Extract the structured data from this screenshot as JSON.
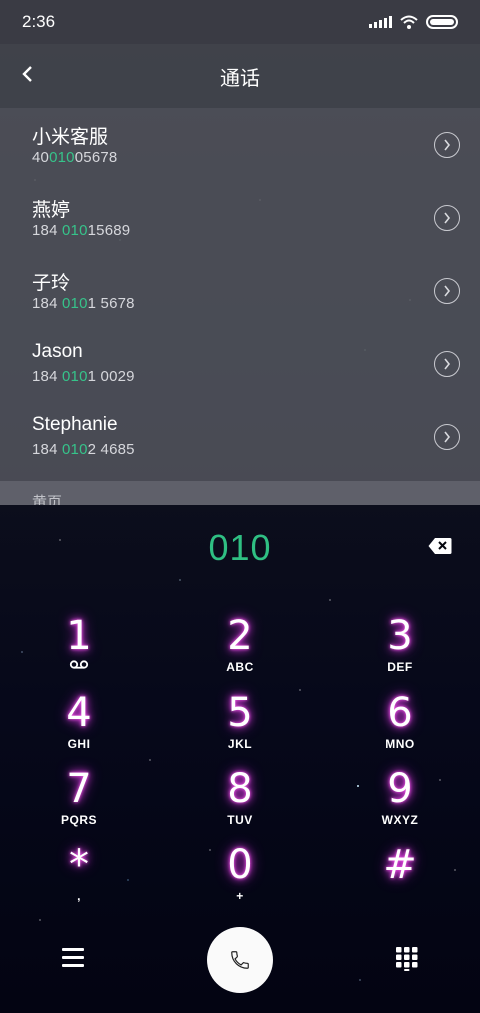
{
  "status_bar": {
    "time": "2:36"
  },
  "header": {
    "title": "通话"
  },
  "contacts": [
    {
      "name": "小米客服",
      "number_pre": "40",
      "number_match": "010",
      "number_post": "05678"
    },
    {
      "name": "燕婷",
      "number_pre": "184 ",
      "number_match": "010",
      "number_post": "15689"
    },
    {
      "name": "子玲",
      "number_pre": "184 ",
      "number_match": "010",
      "number_post": "1 5678"
    },
    {
      "name": "Jason",
      "number_pre": "184 ",
      "number_match": "010",
      "number_post": "1 0029"
    },
    {
      "name": "Stephanie",
      "number_pre": "184 ",
      "number_match": "010",
      "number_post": "2 4685"
    }
  ],
  "section_header": "黄页",
  "dialer": {
    "input": "010"
  },
  "keypad": [
    {
      "digit": "1",
      "letters": ""
    },
    {
      "digit": "2",
      "letters": "ABC"
    },
    {
      "digit": "3",
      "letters": "DEF"
    },
    {
      "digit": "4",
      "letters": "GHI"
    },
    {
      "digit": "5",
      "letters": "JKL"
    },
    {
      "digit": "6",
      "letters": "MNO"
    },
    {
      "digit": "7",
      "letters": "PQRS"
    },
    {
      "digit": "8",
      "letters": "TUV"
    },
    {
      "digit": "9",
      "letters": "WXYZ"
    },
    {
      "digit": "*",
      "letters": ","
    },
    {
      "digit": "0",
      "letters": "+"
    },
    {
      "digit": "#",
      "letters": ""
    }
  ],
  "colors": {
    "match_highlight": "#36c38a",
    "dial_number": "#2fbf83",
    "key_glow": "#e140e6"
  },
  "icons": {
    "back": "chevron-left-icon",
    "detail": "chevron-right-circle-icon",
    "backspace": "backspace-icon",
    "voicemail": "voicemail-icon",
    "menu": "menu-icon",
    "call": "phone-icon",
    "dialpad": "dialpad-icon"
  }
}
